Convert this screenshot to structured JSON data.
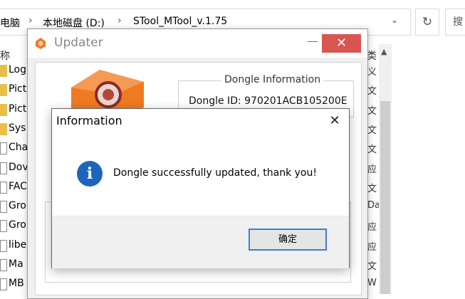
{
  "explorer": {
    "breadcrumbs": [
      "电脑",
      "本地磁盘 (D:)",
      "STool_MTool_v.1.75"
    ],
    "refresh_glyph": "↻",
    "search_partial": "搜",
    "column_name": "称",
    "column_type": "类",
    "files": [
      {
        "name": "Log",
        "kind": "folder"
      },
      {
        "name": "Pict",
        "kind": "folder"
      },
      {
        "name": "Pict",
        "kind": "folder"
      },
      {
        "name": "Sys",
        "kind": "folder"
      },
      {
        "name": "Cha",
        "kind": "doc"
      },
      {
        "name": "Dov",
        "kind": "doc"
      },
      {
        "name": "FAC",
        "kind": "doc"
      },
      {
        "name": "Gro",
        "kind": "doc"
      },
      {
        "name": "Gro",
        "kind": "doc"
      },
      {
        "name": "libe",
        "kind": "doc"
      },
      {
        "name": "Ma",
        "kind": "doc"
      },
      {
        "name": "MB",
        "kind": "doc"
      }
    ],
    "types": [
      "义",
      "文",
      "文",
      "文",
      "文",
      "应",
      "文",
      "Da",
      "应",
      "应",
      "文",
      "W"
    ]
  },
  "updater": {
    "title": "Updater",
    "dongle_legend": "Dongle Information",
    "dongle_id": "Dongle ID: 970201ACB105200E"
  },
  "dialog": {
    "title": "Information",
    "message": "Dongle successfully updated, thank you!",
    "ok_label": "确定",
    "icon_glyph": "i",
    "close_glyph": "✕"
  },
  "colors": {
    "accent": "#1b66bb",
    "close_red": "#d95550",
    "folder": "#e8bf4a",
    "logo_orange": "#f07a22"
  }
}
